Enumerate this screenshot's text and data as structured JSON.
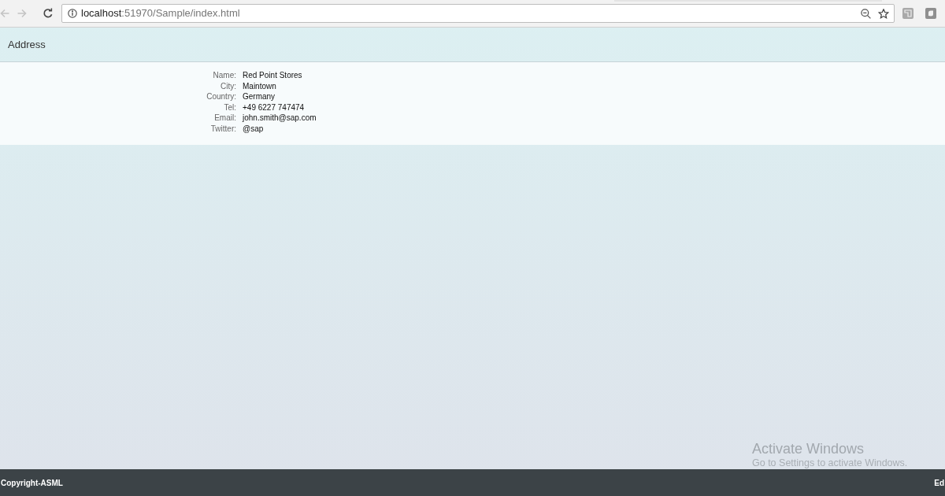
{
  "browser": {
    "back": {
      "disabled": true
    },
    "forward": {
      "disabled": true
    },
    "url": {
      "host": "localhost",
      "path": ":51970/Sample/index.html"
    }
  },
  "page": {
    "title": "Address",
    "fields": [
      {
        "label": "Name:",
        "value": "Red Point Stores"
      },
      {
        "label": "City:",
        "value": "Maintown"
      },
      {
        "label": "Country:",
        "value": "Germany"
      },
      {
        "label": "Tel:",
        "value": "+49 6227 747474"
      },
      {
        "label": "Email:",
        "value": "john.smith@sap.com"
      },
      {
        "label": "Twitter:",
        "value": "@sap"
      }
    ]
  },
  "footer": {
    "left": "Copyright-ASML",
    "right": "Ed"
  },
  "os_notice": {
    "title": "Activate Windows",
    "message": "Go to Settings to activate Windows."
  }
}
